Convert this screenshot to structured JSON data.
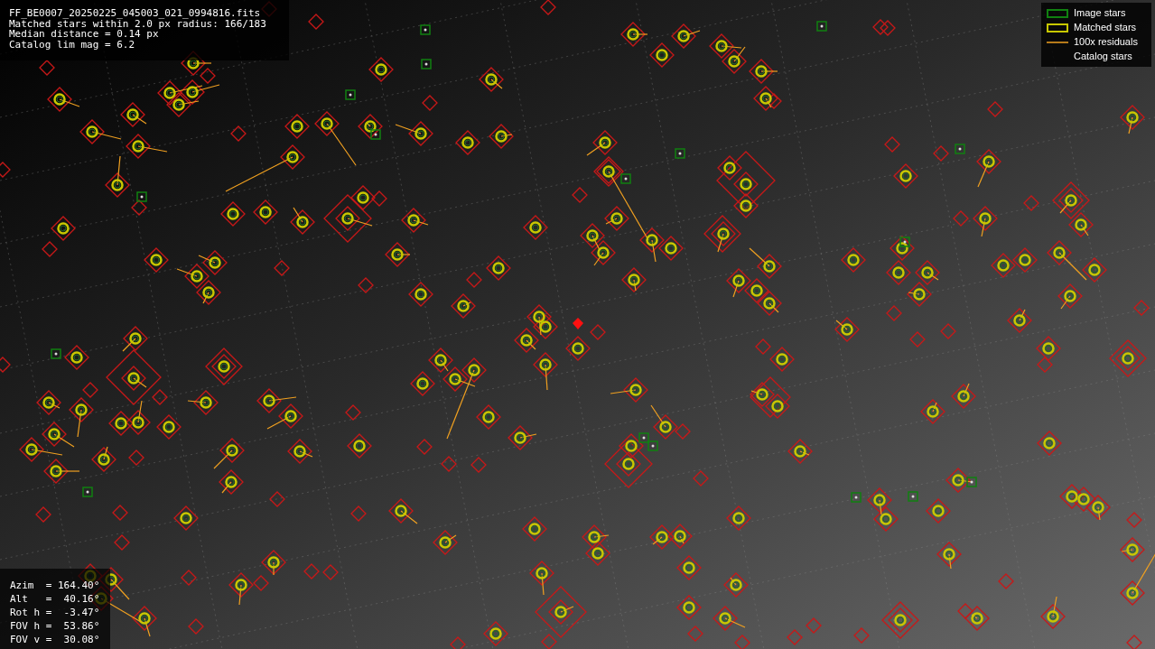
{
  "info_box": {
    "lines": [
      "FF_BE0007_20250225_045003_021_0994816.fits",
      "Matched stars within 2.0 px radius: 166/183",
      "Median distance = 0.14 px",
      "Catalog lim mag = 6.2"
    ]
  },
  "legend": [
    {
      "kind": "image",
      "label": "Image stars"
    },
    {
      "kind": "matched",
      "label": "Matched stars"
    },
    {
      "kind": "residual",
      "label": "100x residuals"
    },
    {
      "kind": "catalog",
      "label": "Catalog stars"
    }
  ],
  "pointing_box": {
    "lines": [
      "Azim  = 164.40°",
      "Alt   =  40.16°",
      "Rot h =  -3.47°",
      "FOV h =  53.86°",
      "FOV v =  30.08°"
    ]
  }
}
